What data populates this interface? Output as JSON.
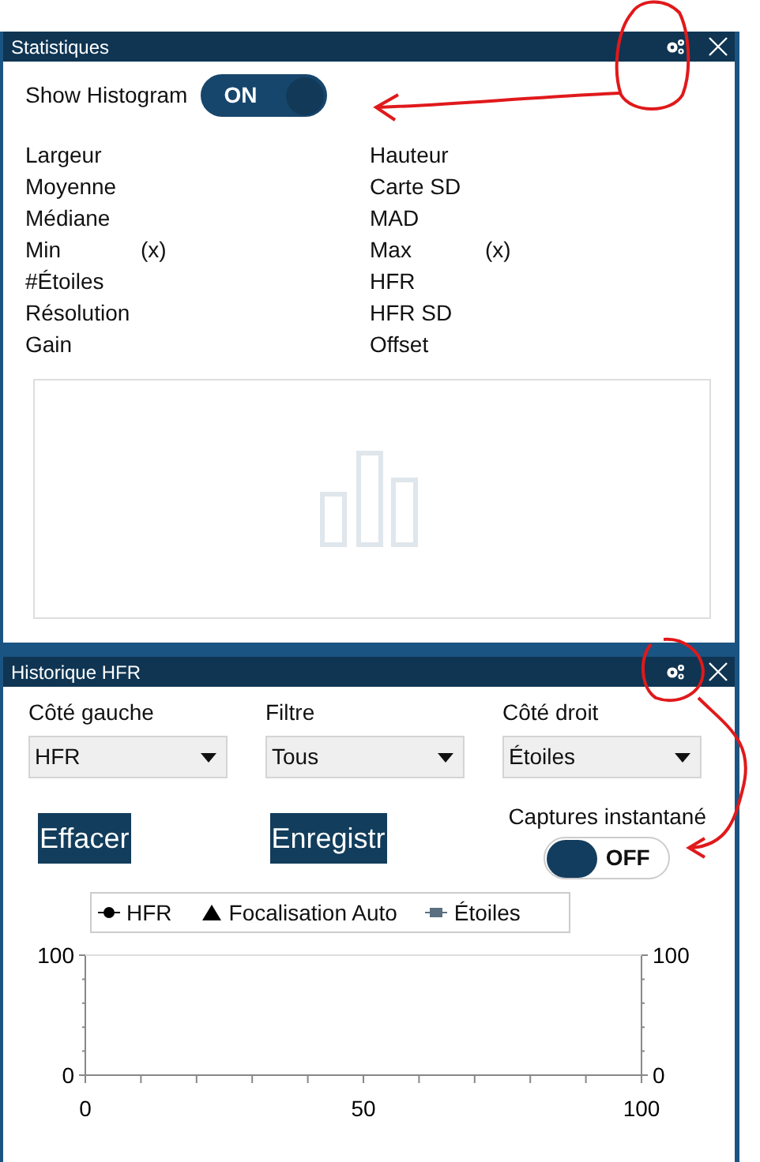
{
  "statistics_panel": {
    "title": "Statistiques",
    "histogram_toggle": {
      "label": "Show Histogram",
      "on": true,
      "state_text": "ON"
    },
    "stats_left": [
      {
        "label": "Largeur"
      },
      {
        "label": "Moyenne"
      },
      {
        "label": "Médiane"
      },
      {
        "label": "Min",
        "suffix": "(x)"
      },
      {
        "label": "#Étoiles"
      },
      {
        "label": "Résolution"
      },
      {
        "label": "Gain"
      }
    ],
    "stats_right": [
      {
        "label": "Hauteur"
      },
      {
        "label": "Carte SD"
      },
      {
        "label": "MAD"
      },
      {
        "label": "Max",
        "suffix": "(x)"
      },
      {
        "label": "HFR"
      },
      {
        "label": "HFR SD"
      },
      {
        "label": "Offset"
      }
    ]
  },
  "hfr_panel": {
    "title": "Historique HFR",
    "dropdowns": [
      {
        "label": "Côté gauche",
        "value": "HFR"
      },
      {
        "label": "Filtre",
        "value": "Tous"
      },
      {
        "label": "Côté droit",
        "value": "Étoiles"
      }
    ],
    "buttons": [
      "Effacer",
      "Enregistr"
    ],
    "snapshot_toggle": {
      "label": "Captures instantané",
      "on": false,
      "state_text": "OFF"
    },
    "chart_data": {
      "type": "line",
      "series": [
        {
          "name": "HFR",
          "color": "#000000",
          "marker": "circle",
          "values": [
            null,
            null,
            null
          ]
        },
        {
          "name": "Focalisation Auto",
          "color": "#000000",
          "marker": "triangle",
          "values": [
            null,
            null,
            null
          ]
        },
        {
          "name": "Étoiles",
          "color": "#5a7080",
          "marker": "square",
          "values": [
            null,
            null,
            null
          ]
        }
      ],
      "categories": [
        "0",
        "50",
        "100"
      ],
      "ylim": [
        0,
        100
      ],
      "y2lim": [
        0,
        100
      ],
      "yticks": [
        0,
        100
      ],
      "y2ticks": [
        0,
        100
      ]
    }
  },
  "markup": [
    {
      "kind": "circle"
    },
    {
      "kind": "arrow"
    },
    {
      "kind": "circle"
    },
    {
      "kind": "arrow"
    }
  ]
}
